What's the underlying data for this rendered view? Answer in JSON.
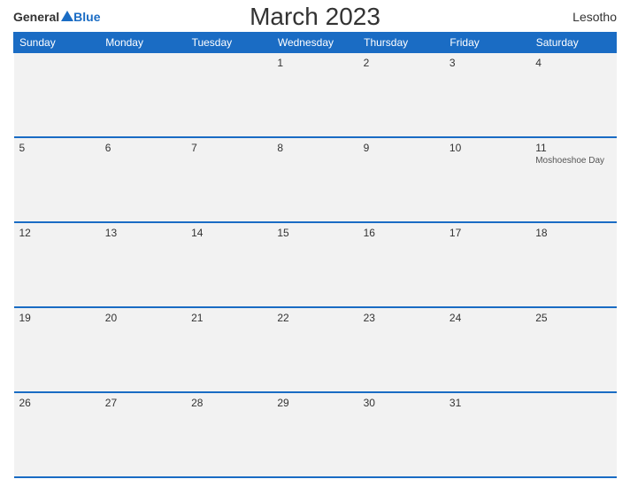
{
  "header": {
    "logo": {
      "general": "General",
      "blue": "Blue",
      "triangle": true
    },
    "title": "March 2023",
    "country": "Lesotho"
  },
  "calendar": {
    "weekdays": [
      "Sunday",
      "Monday",
      "Tuesday",
      "Wednesday",
      "Thursday",
      "Friday",
      "Saturday"
    ],
    "weeks": [
      [
        {
          "day": "",
          "event": ""
        },
        {
          "day": "",
          "event": ""
        },
        {
          "day": "",
          "event": ""
        },
        {
          "day": "1",
          "event": ""
        },
        {
          "day": "2",
          "event": ""
        },
        {
          "day": "3",
          "event": ""
        },
        {
          "day": "4",
          "event": ""
        }
      ],
      [
        {
          "day": "5",
          "event": ""
        },
        {
          "day": "6",
          "event": ""
        },
        {
          "day": "7",
          "event": ""
        },
        {
          "day": "8",
          "event": ""
        },
        {
          "day": "9",
          "event": ""
        },
        {
          "day": "10",
          "event": ""
        },
        {
          "day": "11",
          "event": "Moshoeshoe Day"
        }
      ],
      [
        {
          "day": "12",
          "event": ""
        },
        {
          "day": "13",
          "event": ""
        },
        {
          "day": "14",
          "event": ""
        },
        {
          "day": "15",
          "event": ""
        },
        {
          "day": "16",
          "event": ""
        },
        {
          "day": "17",
          "event": ""
        },
        {
          "day": "18",
          "event": ""
        }
      ],
      [
        {
          "day": "19",
          "event": ""
        },
        {
          "day": "20",
          "event": ""
        },
        {
          "day": "21",
          "event": ""
        },
        {
          "day": "22",
          "event": ""
        },
        {
          "day": "23",
          "event": ""
        },
        {
          "day": "24",
          "event": ""
        },
        {
          "day": "25",
          "event": ""
        }
      ],
      [
        {
          "day": "26",
          "event": ""
        },
        {
          "day": "27",
          "event": ""
        },
        {
          "day": "28",
          "event": ""
        },
        {
          "day": "29",
          "event": ""
        },
        {
          "day": "30",
          "event": ""
        },
        {
          "day": "31",
          "event": ""
        },
        {
          "day": "",
          "event": ""
        }
      ]
    ]
  }
}
